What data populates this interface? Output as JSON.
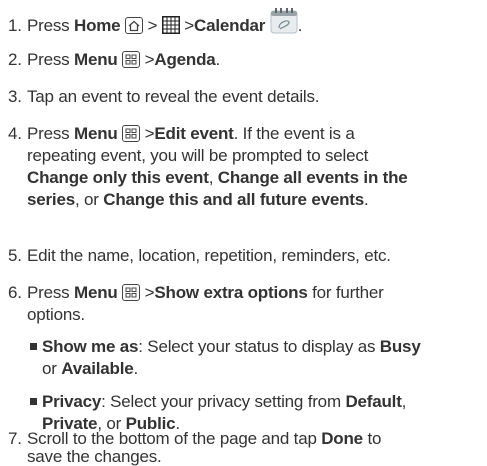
{
  "steps": [
    {
      "num": "1.",
      "pre": "Press",
      "b1": "Home",
      "gt": ">",
      "gt2": ">",
      "b2": "Calendar",
      "post": "."
    },
    {
      "num": "2.",
      "pre": "Press",
      "b1": "Menu",
      "gt": ">",
      "b2": "Agenda",
      "post": "."
    },
    {
      "num": "3.",
      "text": "Tap an event to reveal the event details."
    },
    {
      "num": "4.",
      "pre": "Press",
      "b1": "Menu",
      "gt": ">",
      "b2": "Edit event",
      "l1rest": ". If the event is a",
      "l2": "repeating event, you will be prompted to select",
      "b3": "Change only this event",
      "c1": ",",
      "b4": "Change all events in the",
      "b5": "series",
      "c2": ", or",
      "b6": "Change this and all future events",
      "post": "."
    },
    {
      "num": "5.",
      "text": "Edit the name, location, repetition, reminders, etc."
    },
    {
      "num": "6.",
      "pre": "Press",
      "b1": "Menu",
      "gt": ">",
      "b2": "Show extra options",
      "l1rest": "for further",
      "l2": "options."
    },
    {
      "num": "7.",
      "l1": "Scroll to the bottom of the page and tap",
      "b1": "Done",
      "l1rest": "to",
      "l2": "save the changes."
    }
  ],
  "subitems": [
    {
      "b1": "Show me as",
      "t1": ": Select your status to display as",
      "b2": "Busy",
      "t2": "or",
      "b3": "Available",
      "post": "."
    },
    {
      "b1": "Privacy",
      "t1": ": Select your privacy setting from",
      "b2": "Default",
      "c1": ",",
      "b3": "Private",
      "t2": ", or",
      "b4": "Public",
      "post": "."
    }
  ],
  "icons": {
    "home": "home-key-icon",
    "apps": "apps-grid-icon",
    "calendar": "calendar-app-icon",
    "menu": "menu-key-icon"
  }
}
